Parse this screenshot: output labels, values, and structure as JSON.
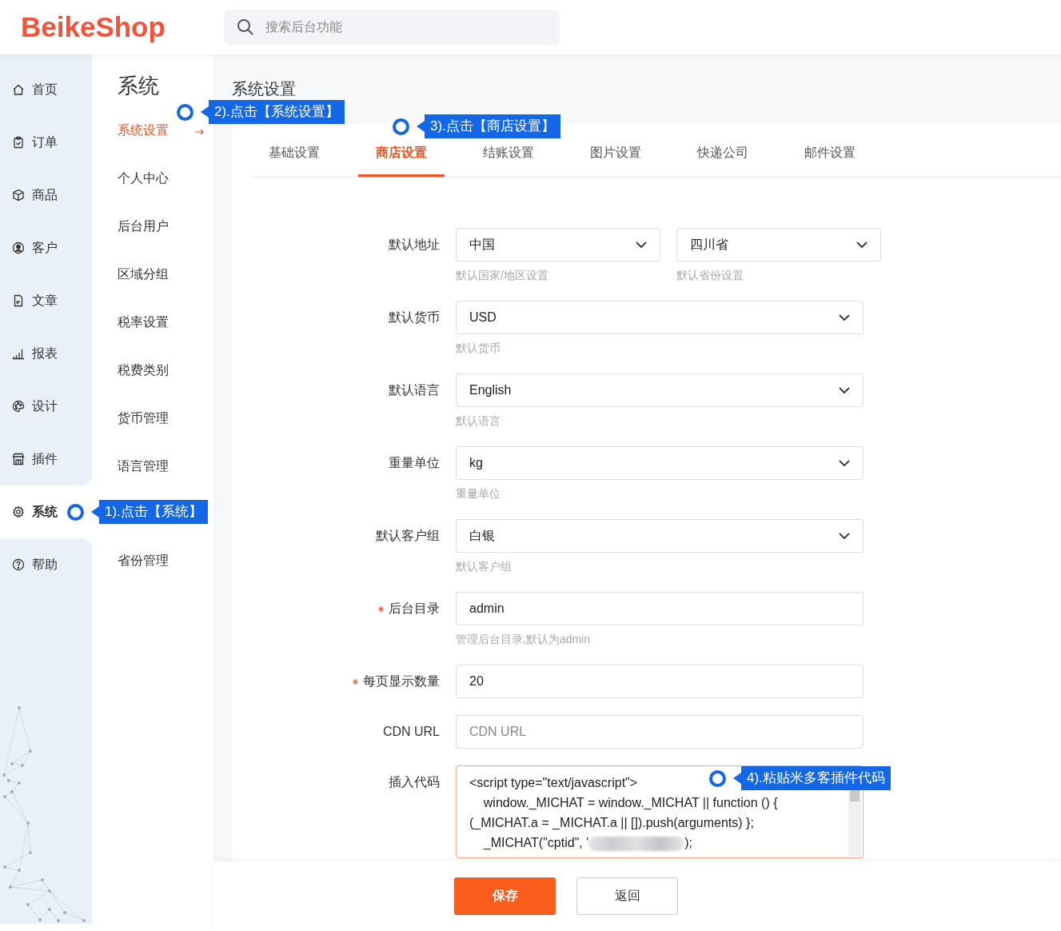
{
  "logo": "BeikeShop",
  "search": {
    "placeholder": "搜索后台功能"
  },
  "nav": [
    {
      "label": "首页",
      "selected": false
    },
    {
      "label": "订单",
      "selected": false
    },
    {
      "label": "商品",
      "selected": false
    },
    {
      "label": "客户",
      "selected": false
    },
    {
      "label": "文章",
      "selected": false
    },
    {
      "label": "报表",
      "selected": false
    },
    {
      "label": "设计",
      "selected": false
    },
    {
      "label": "插件",
      "selected": false
    },
    {
      "label": "系统",
      "selected": true,
      "callout": "1).点击【系统】"
    },
    {
      "label": "帮助",
      "selected": false
    }
  ],
  "submenu": {
    "title": "系统",
    "items": [
      {
        "label": "系统设置",
        "selected": true,
        "callout": "2).点击【系统设置】"
      },
      {
        "label": "个人中心",
        "selected": false
      },
      {
        "label": "后台用户",
        "selected": false
      },
      {
        "label": "区域分组",
        "selected": false
      },
      {
        "label": "税率设置",
        "selected": false
      },
      {
        "label": "税费类别",
        "selected": false
      },
      {
        "label": "货币管理",
        "selected": false
      },
      {
        "label": "语言管理",
        "selected": false
      },
      {
        "label": "省份管理",
        "selected": false
      }
    ]
  },
  "page_title": "系统设置",
  "tabs": [
    {
      "label": "基础设置",
      "selected": false
    },
    {
      "label": "商店设置",
      "selected": true,
      "callout": "3).点击【商店设置】"
    },
    {
      "label": "结账设置",
      "selected": false
    },
    {
      "label": "图片设置",
      "selected": false
    },
    {
      "label": "快递公司",
      "selected": false
    },
    {
      "label": "邮件设置",
      "selected": false
    }
  ],
  "form": [
    {
      "kind": "select_pair",
      "label": "默认地址",
      "fields": [
        {
          "value": "中国",
          "help": "默认国家/地区设置"
        },
        {
          "value": "四川省",
          "help": "默认省份设置"
        }
      ]
    },
    {
      "kind": "select",
      "label": "默认货币",
      "value": "USD",
      "help": "默认货币"
    },
    {
      "kind": "select",
      "label": "默认语言",
      "value": "English",
      "help": "默认语言"
    },
    {
      "kind": "select",
      "label": "重量单位",
      "value": "kg",
      "help": "重量单位"
    },
    {
      "kind": "select",
      "label": "默认客户组",
      "value": "白银",
      "help": "默认客户组"
    },
    {
      "kind": "input",
      "label": "后台目录",
      "required": true,
      "value": "admin",
      "help": "管理后台目录,默认为admin"
    },
    {
      "kind": "input",
      "label": "每页显示数量",
      "required": true,
      "value": "20"
    },
    {
      "kind": "input",
      "label": "CDN URL",
      "placeholder": "CDN URL"
    },
    {
      "kind": "code",
      "label": "插入代码",
      "callout": "4).粘贴米多客插件代码",
      "lines": [
        {
          "text": "<script type=\"text/javascript\">"
        },
        {
          "text": "    window._MICHAT = window._MICHAT || function () {"
        },
        {
          "text": "(_MICHAT.a = _MICHAT.a || []).push(arguments) };"
        },
        {
          "text": "    _MICHAT(\"cptid\", '",
          "redacted": true,
          "tail": ");"
        }
      ]
    }
  ],
  "buttons": [
    {
      "label": "保存",
      "kind": "primary"
    },
    {
      "label": "返回",
      "kind": "default"
    }
  ]
}
